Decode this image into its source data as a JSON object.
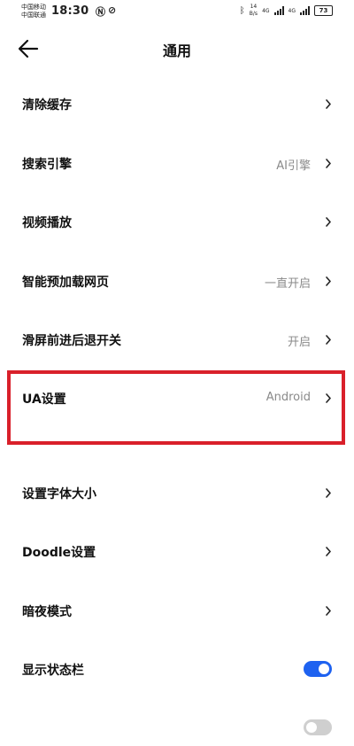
{
  "status_bar": {
    "carrier_1": "中国移动",
    "carrier_2": "中国联通",
    "time": "18:30",
    "speed_value": "14",
    "speed_unit": "B/s",
    "network_1": "4G",
    "network_2": "4G",
    "battery": "73"
  },
  "header": {
    "title": "通用"
  },
  "settings": [
    {
      "label": "清除缓存",
      "value": ""
    },
    {
      "label": "搜索引擎",
      "value": "AI引擎"
    },
    {
      "label": "视频播放",
      "value": ""
    },
    {
      "label": "智能预加载网页",
      "value": "一直开启"
    },
    {
      "label": "滑屏前进后退开关",
      "value": "开启"
    },
    {
      "label": "UA设置",
      "value": "Android"
    },
    {
      "label": "设置字体大小",
      "value": ""
    },
    {
      "label": "Doodle设置",
      "value": ""
    },
    {
      "label": "暗夜模式",
      "value": ""
    },
    {
      "label": "显示状态栏",
      "toggle": "on"
    }
  ],
  "colors": {
    "accent": "#1e62f0",
    "highlight": "#d9202a",
    "secondary_text": "#8a8a8a"
  }
}
